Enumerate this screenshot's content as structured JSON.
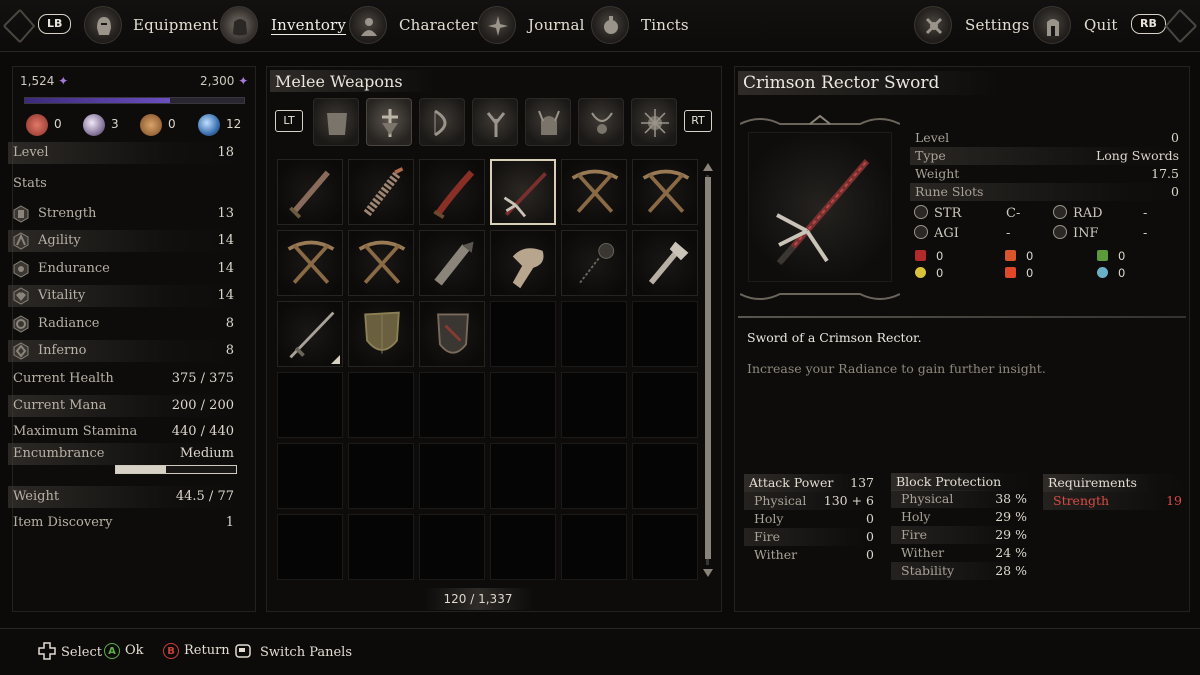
{
  "nav": {
    "lb": "LB",
    "rb": "RB",
    "tabs": [
      {
        "label": "Equipment",
        "icon": "helmet-icon"
      },
      {
        "label": "Inventory",
        "icon": "bag-icon"
      },
      {
        "label": "Character",
        "icon": "character-icon"
      },
      {
        "label": "Journal",
        "icon": "journal-icon"
      },
      {
        "label": "Tincts",
        "icon": "tinct-icon"
      }
    ],
    "settings": "Settings",
    "quit": "Quit"
  },
  "character": {
    "currency_left": "1,524",
    "currency_right": "2,300",
    "xp_fraction": 0.66,
    "resources": [
      "0",
      "3",
      "0",
      "12"
    ],
    "level_label": "Level",
    "level": "18",
    "stats_label": "Stats",
    "stats": [
      {
        "label": "Strength",
        "value": "13"
      },
      {
        "label": "Agility",
        "value": "14"
      },
      {
        "label": "Endurance",
        "value": "14"
      },
      {
        "label": "Vitality",
        "value": "14"
      },
      {
        "label": "Radiance",
        "value": "8"
      },
      {
        "label": "Inferno",
        "value": "8"
      }
    ],
    "current_health_label": "Current Health",
    "current_health": "375 / 375",
    "current_mana_label": "Current Mana",
    "current_mana": "200 / 200",
    "max_stamina_label": "Maximum Stamina",
    "max_stamina": "440 / 440",
    "encumbrance_label": "Encumbrance",
    "encumbrance": "Medium",
    "encumbrance_fraction": 0.42,
    "weight_label": "Weight",
    "weight": "44.5 / 77",
    "item_discovery_label": "Item Discovery",
    "item_discovery": "1"
  },
  "inventory": {
    "category_title": "Melee Weapons",
    "lt": "LT",
    "rt": "RT",
    "count": "120 / 1,337",
    "items": [
      "short-sword-icon",
      "wrapped-club-icon",
      "curved-dagger-icon",
      "spear-icon",
      "crossbow-icon",
      "crossbow-icon",
      "crossbow-icon",
      "crossbow-icon",
      "gauntlet-icon",
      "fur-club-icon",
      "flail-icon",
      "hammer-icon",
      "long-sword-icon",
      "kite-shield-icon",
      "round-shield-icon"
    ]
  },
  "item": {
    "name": "Crimson Rector Sword",
    "details": [
      {
        "label": "Level",
        "value": "0"
      },
      {
        "label": "Type",
        "value": "Long Swords"
      },
      {
        "label": "Weight",
        "value": "17.5"
      },
      {
        "label": "Rune Slots",
        "value": "0"
      }
    ],
    "scaling": [
      {
        "label": "STR",
        "value": "C-"
      },
      {
        "label": "RAD",
        "value": "-"
      },
      {
        "label": "AGI",
        "value": "-"
      },
      {
        "label": "INF",
        "value": "-"
      }
    ],
    "elements": [
      "0",
      "0",
      "0",
      "0",
      "0",
      "0"
    ],
    "desc_primary": "Sword of a Crimson Rector.",
    "desc_secondary": "Increase your Radiance to gain further insight.",
    "attack_power_label": "Attack Power",
    "attack_power": "137",
    "attack_rows": [
      {
        "label": "Physical",
        "value": "130 + 6"
      },
      {
        "label": "Holy",
        "value": "0"
      },
      {
        "label": "Fire",
        "value": "0"
      },
      {
        "label": "Wither",
        "value": "0"
      }
    ],
    "block_label": "Block Protection",
    "block_rows": [
      {
        "label": "Physical",
        "value": "38 %"
      },
      {
        "label": "Holy",
        "value": "29 %"
      },
      {
        "label": "Fire",
        "value": "29 %"
      },
      {
        "label": "Wither",
        "value": "24 %"
      },
      {
        "label": "Stability",
        "value": "28 %"
      }
    ],
    "requirements_label": "Requirements",
    "requirements": [
      {
        "label": "Strength",
        "value": "19"
      }
    ]
  },
  "hints": [
    {
      "glyph": "dpad-icon",
      "label": "Select"
    },
    {
      "glyph": "A",
      "label": "Ok"
    },
    {
      "glyph": "B",
      "label": "Return"
    },
    {
      "glyph": "view-button-icon",
      "label": "Switch Panels"
    }
  ],
  "colors": {
    "xp_fill": "#6a4fc0",
    "requirement_unmet": "#d94b45",
    "button_a": "#5fae4a",
    "button_b": "#c8413c"
  }
}
